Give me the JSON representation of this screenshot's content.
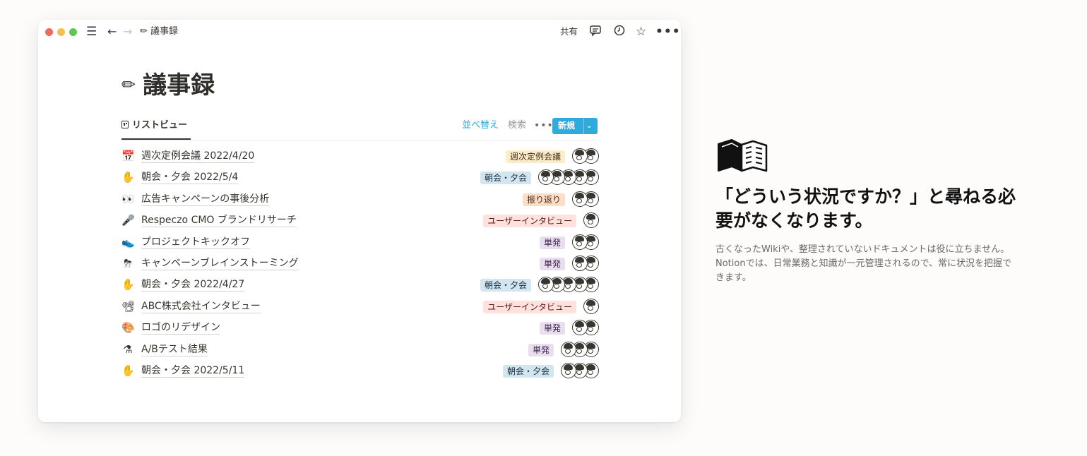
{
  "titlebar": {
    "menu_icon": "☰",
    "back_icon": "←",
    "forward_icon": "→",
    "page_icon": "✏",
    "page_name": "議事録",
    "share_label": "共有",
    "comment_icon": "🗨",
    "history_icon": "◷",
    "star_icon": "☆",
    "more_icon": "•••"
  },
  "page": {
    "icon": "✏",
    "title": "議事録"
  },
  "view": {
    "tab_label": "リストビュー",
    "sort_label": "並べ替え",
    "search_label": "検索",
    "more_label": "•••",
    "new_label": "新規",
    "new_dropdown_icon": "⌄"
  },
  "rows": [
    {
      "icon": "📅",
      "title": "週次定例会議 2022/4/20",
      "tag": "週次定例会議",
      "tag_bg": "#fdecc8",
      "tag_color": "#402c1b",
      "avatars": 2
    },
    {
      "icon": "✋",
      "title": "朝会・夕会 2022/5/4",
      "tag": "朝会・夕会",
      "tag_bg": "#d3e5ef",
      "tag_color": "#183347",
      "avatars": 5
    },
    {
      "icon": "👀",
      "title": "広告キャンペーンの事後分析",
      "tag": "振り返り",
      "tag_bg": "#fadec9",
      "tag_color": "#49290e",
      "avatars": 2
    },
    {
      "icon": "🎤",
      "title": "Respeczo CMO ブランドリサーチ",
      "tag": "ユーザーインタビュー",
      "tag_bg": "#ffe2dd",
      "tag_color": "#5d1715",
      "avatars": 1
    },
    {
      "icon": "👟",
      "title": "プロジェクトキックオフ",
      "tag": "単発",
      "tag_bg": "#e8deee",
      "tag_color": "#412454",
      "avatars": 2
    },
    {
      "icon": "⛈",
      "title": "キャンペーンブレインストーミング",
      "tag": "単発",
      "tag_bg": "#e8deee",
      "tag_color": "#412454",
      "avatars": 2
    },
    {
      "icon": "✋",
      "title": "朝会・夕会 2022/4/27",
      "tag": "朝会・夕会",
      "tag_bg": "#d3e5ef",
      "tag_color": "#183347",
      "avatars": 5
    },
    {
      "icon": "📽",
      "title": "ABC株式会社インタビュー",
      "tag": "ユーザーインタビュー",
      "tag_bg": "#ffe2dd",
      "tag_color": "#5d1715",
      "avatars": 1
    },
    {
      "icon": "🎨",
      "title": "ロゴのリデザイン",
      "tag": "単発",
      "tag_bg": "#e8deee",
      "tag_color": "#412454",
      "avatars": 2
    },
    {
      "icon": "⚗",
      "title": "A/Bテスト結果",
      "tag": "単発",
      "tag_bg": "#e8deee",
      "tag_color": "#412454",
      "avatars": 3
    },
    {
      "icon": "✋",
      "title": "朝会・夕会 2022/5/11",
      "tag": "朝会・夕会",
      "tag_bg": "#d3e5ef",
      "tag_color": "#183347",
      "avatars": 3
    }
  ],
  "side": {
    "icon": "open-book-icon",
    "headline": "「どういう状況ですか？」と尋ねる必要がなくなります。",
    "description": "古くなったWikiや、整理されていないドキュメントは役に立ちません。Notionでは、日常業務と知識が一元管理されるので、常に状況を把握できます。"
  }
}
